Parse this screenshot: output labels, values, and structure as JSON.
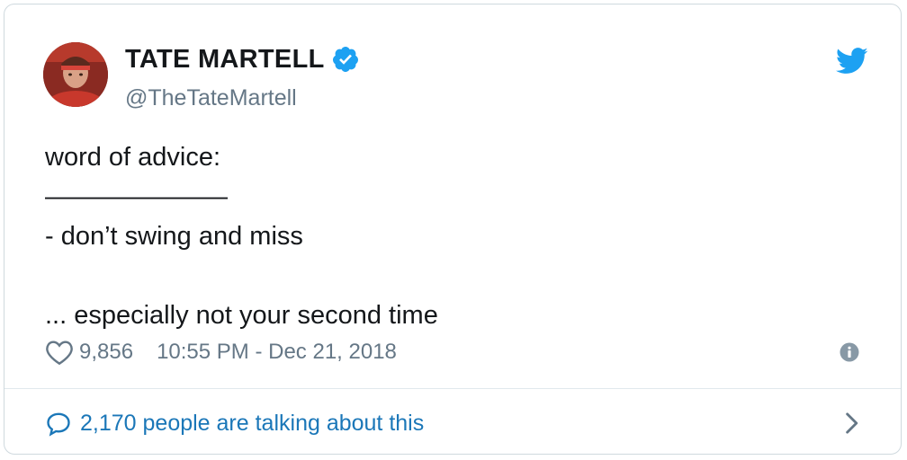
{
  "author": {
    "display_name": "TATE MARTELL",
    "handle": "@TheTateMartell",
    "verified": true,
    "avatar_icon": "user-avatar"
  },
  "tweet": {
    "lines": [
      "word of advice:",
      "———————",
      "- don’t swing and miss",
      "",
      "... especially not your second time"
    ],
    "likes": "9,856",
    "timestamp": "10:55 PM - Dec 21, 2018"
  },
  "footer": {
    "talking_text": "2,170 people are talking about this"
  },
  "icons": {
    "brand": "twitter-bird-icon",
    "verified": "verified-badge-icon",
    "like": "heart-icon",
    "info": "info-icon",
    "conversation": "speech-bubble-icon",
    "more": "chevron-right-icon"
  },
  "colors": {
    "brand_blue": "#1da1f2",
    "link_blue": "#1b77b8",
    "text_primary": "#14171a",
    "text_secondary": "#657786",
    "border": "#cfd9de"
  }
}
